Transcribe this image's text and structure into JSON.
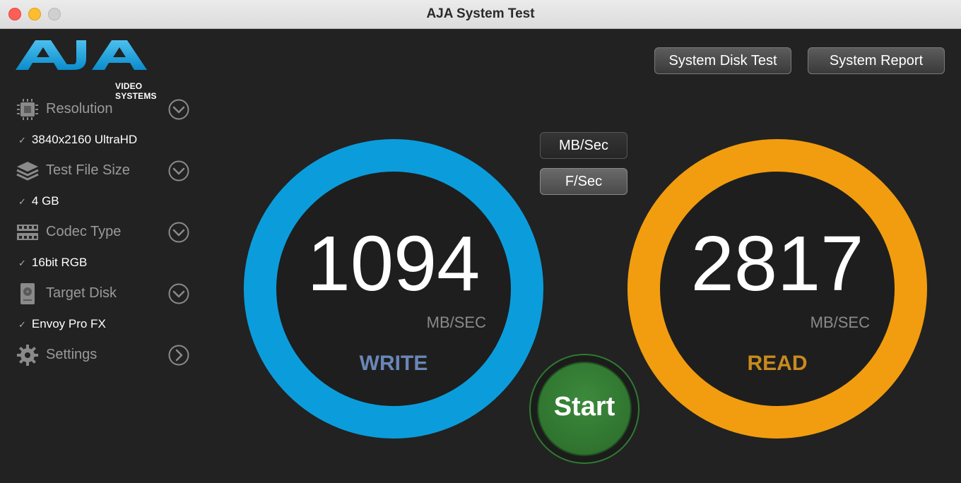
{
  "window": {
    "title": "AJA System Test"
  },
  "logo": {
    "brand": "AJA",
    "subtitle": "VIDEO SYSTEMS",
    "color": "#1ea0dc"
  },
  "header": {
    "system_disk_test": "System Disk Test",
    "system_report": "System Report"
  },
  "sidebar": {
    "sections": [
      {
        "label": "Resolution",
        "value": "3840x2160 UltraHD",
        "icon": "chip-icon"
      },
      {
        "label": "Test File Size",
        "value": "4 GB",
        "icon": "layers-icon"
      },
      {
        "label": "Codec Type",
        "value": "16bit RGB",
        "icon": "film-icon"
      },
      {
        "label": "Target Disk",
        "value": "Envoy Pro FX",
        "icon": "disk-icon"
      },
      {
        "label": "Settings",
        "icon": "gear-icon"
      }
    ],
    "check_mark": "✓"
  },
  "units": {
    "mb_sec": "MB/Sec",
    "f_sec": "F/Sec",
    "selected": "F/Sec"
  },
  "write": {
    "value": "1094",
    "unit": "MB/SEC",
    "label": "WRITE",
    "ring_color": "#0b9ddb",
    "label_color": "#6a86b8"
  },
  "read": {
    "value": "2817",
    "unit": "MB/SEC",
    "label": "READ",
    "ring_color": "#f29d0f",
    "label_color": "#c98a1e"
  },
  "start": {
    "label": "Start",
    "color": "#2f7a2f"
  }
}
